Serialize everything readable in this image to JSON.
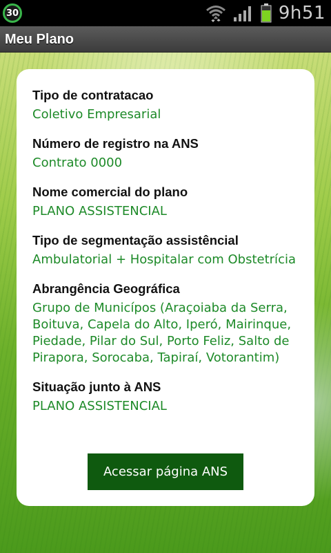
{
  "status_bar": {
    "badge": "30",
    "time": "9h51",
    "icons": [
      "wifi-icon",
      "signal-icon",
      "battery-icon"
    ]
  },
  "title_bar": {
    "title": "Meu Plano"
  },
  "plan": {
    "fields": [
      {
        "label": "Tipo de contratacao",
        "value": "Coletivo Empresarial"
      },
      {
        "label": "Número de registro na ANS",
        "value": "Contrato 0000"
      },
      {
        "label": "Nome comercial do plano",
        "value": "PLANO ASSISTENCIAL"
      },
      {
        "label": "Tipo de segmentação assistêncial",
        "value": "Ambulatorial + Hospitalar com Obstetrícia"
      },
      {
        "label": "Abrangência Geográfica",
        "value": "Grupo de Municípos (Araçoiaba da Serra, Boituva, Capela do Alto, Iperó, Mairinque, Piedade, Pilar do Sul, Porto Feliz, Salto de Pirapora, Sorocaba, Tapiraí, Votorantim)"
      },
      {
        "label": "Situação junto à ANS",
        "value": "PLANO ASSISTENCIAL"
      }
    ],
    "button_label": "Acessar página ANS"
  },
  "colors": {
    "accent_green": "#1d8a28",
    "button_green": "#0f5a0f",
    "badge_ring": "#39b64a",
    "battery_green": "#7ed321"
  }
}
